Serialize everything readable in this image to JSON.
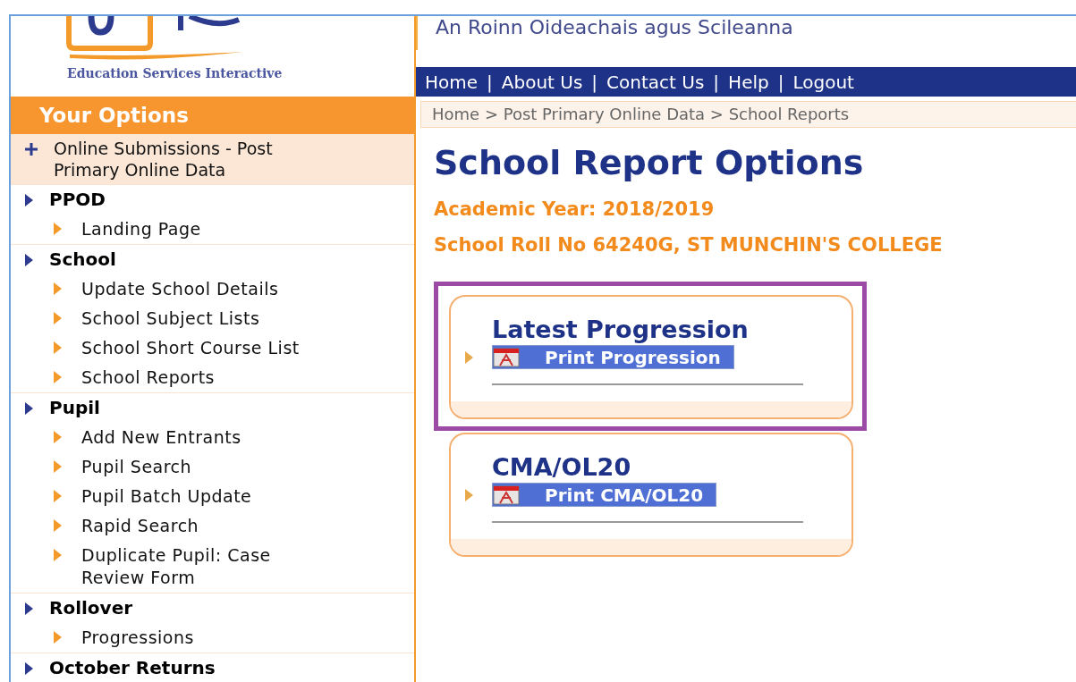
{
  "logo": {
    "tagline": "Education Services Interactive"
  },
  "header": {
    "department": "An Roinn Oideachais agus Scileanna"
  },
  "nav": [
    "Home",
    "About Us",
    "Contact Us",
    "Help",
    "Logout"
  ],
  "nav_separator": "|",
  "breadcrumb": "Home > Post Primary Online Data > School Reports",
  "sidebar": {
    "title": "Your Options",
    "sections": [
      {
        "kind": "plus",
        "label": "Online Submissions - Post Primary Online Data",
        "selected": true
      },
      {
        "kind": "group",
        "label": "PPOD",
        "selected": false,
        "children": [
          {
            "label": "Landing Page"
          }
        ]
      },
      {
        "kind": "group",
        "label": "School",
        "selected": false,
        "children": [
          {
            "label": "Update School Details"
          },
          {
            "label": "School Subject Lists"
          },
          {
            "label": "School Short Course List"
          },
          {
            "label": "School Reports"
          }
        ]
      },
      {
        "kind": "group",
        "label": "Pupil",
        "selected": false,
        "children": [
          {
            "label": "Add New Entrants"
          },
          {
            "label": "Pupil Search"
          },
          {
            "label": "Pupil Batch Update"
          },
          {
            "label": "Rapid Search"
          },
          {
            "label": "Duplicate Pupil: Case Review Form"
          }
        ]
      },
      {
        "kind": "group",
        "label": "Rollover",
        "selected": false,
        "children": [
          {
            "label": "Progressions"
          }
        ]
      },
      {
        "kind": "group",
        "label": "October Returns",
        "selected": false
      }
    ]
  },
  "page": {
    "title": "School Report Options",
    "academic_year": "Academic Year: 2018/2019",
    "school": "School Roll No 64240G, ST MUNCHIN'S COLLEGE"
  },
  "cards": [
    {
      "title": "Latest Progression",
      "link": "Print Progression",
      "highlighted": true
    },
    {
      "title": "CMA/OL20",
      "link": "Print CMA/OL20",
      "highlighted": false
    }
  ]
}
